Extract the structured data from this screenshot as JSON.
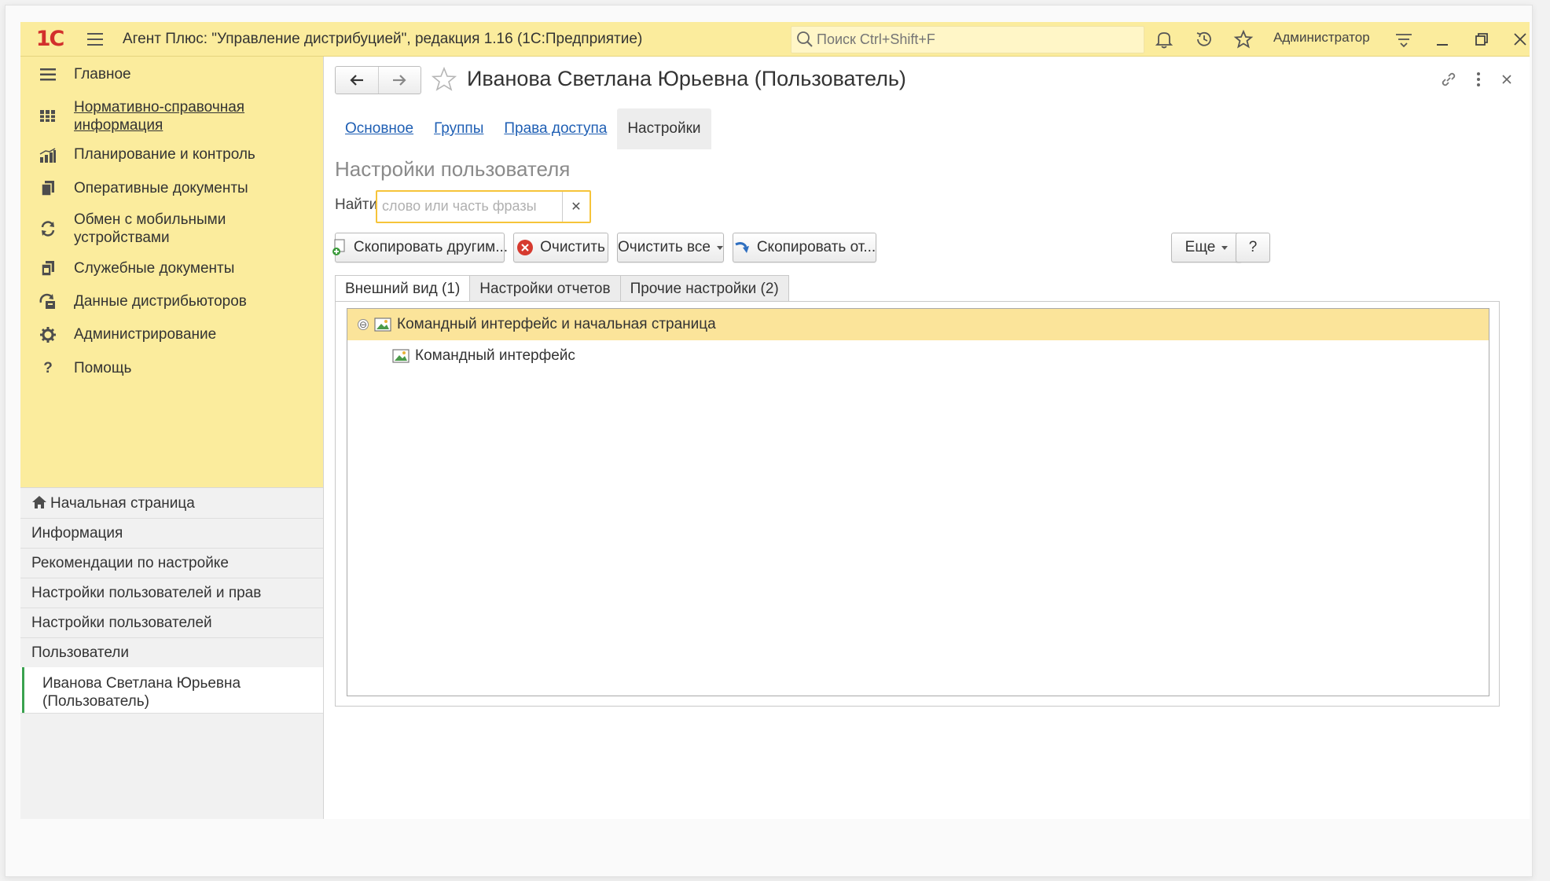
{
  "titlebar": {
    "logo": "1С",
    "app_title": "Агент Плюс: \"Управление дистрибуцией\", редакция 1.16  (1С:Предприятие)",
    "search_placeholder": "Поиск Ctrl+Shift+F",
    "user": "Администратор"
  },
  "sidebar": {
    "sections": [
      {
        "label": "Главное",
        "icon": "menu-lines-icon"
      },
      {
        "label": "Нормативно-справочная информация",
        "line1": "Нормативно-справочная",
        "line2": "информация",
        "icon": "grid-book-icon"
      },
      {
        "label": "Планирование и контроль",
        "icon": "chart-icon"
      },
      {
        "label": "Оперативные документы",
        "icon": "documents-icon"
      },
      {
        "label": "Обмен с мобильными устройствами",
        "line1": "Обмен с мобильными",
        "line2": "устройствами",
        "icon": "sync-icon"
      },
      {
        "label": "Служебные документы",
        "icon": "service-docs-icon"
      },
      {
        "label": "Данные дистрибьюторов",
        "icon": "distributor-icon"
      },
      {
        "label": "Администрирование",
        "icon": "gear-icon"
      },
      {
        "label": "Помощь",
        "icon": "question-icon"
      }
    ],
    "open_windows": [
      {
        "label": "Начальная страница",
        "icon": "home-icon"
      },
      {
        "label": "Информация"
      },
      {
        "label": "Рекомендации по настройке"
      },
      {
        "label": "Настройки пользователей и прав"
      },
      {
        "label": "Настройки пользователей"
      },
      {
        "label": "Пользователи"
      },
      {
        "label": "Иванова Светлана Юрьевна (Пользователь)",
        "line1": "Иванова Светлана Юрьевна",
        "line2": "(Пользователь)",
        "active": true
      }
    ]
  },
  "form": {
    "title": "Иванова Светлана Юрьевна (Пользователь)",
    "tabs": [
      "Основное",
      "Группы",
      "Права доступа",
      "Настройки"
    ],
    "selected_tab": "Настройки",
    "section_title": "Настройки пользователя",
    "find_label": "Найти:",
    "find_placeholder": "слово или часть фразы",
    "find_value": "",
    "buttons": {
      "copy_to_others": "Скопировать другим...",
      "clear": "Очистить",
      "clear_all": "Очистить все",
      "copy_from": "Скопировать от...",
      "more": "Еще",
      "help": "?"
    },
    "inner_tabs": [
      "Внешний вид (1)",
      "Настройки отчетов",
      "Прочие настройки (2)"
    ],
    "selected_inner_tab": "Внешний вид (1)",
    "tree": [
      {
        "label": "Командный интерфейс и начальная страница",
        "level": 0,
        "expanded": true,
        "selected": true,
        "expander": "⊖"
      },
      {
        "label": "Командный интерфейс",
        "level": 1,
        "selected": false
      }
    ]
  },
  "colors": {
    "accent_yellow": "#fbec9d",
    "selected_row": "#fbe49a",
    "link": "#1f5fb4",
    "focus_border": "#f6c43a",
    "active_marker": "#3aa24f",
    "logo_red": "#d2302c"
  }
}
